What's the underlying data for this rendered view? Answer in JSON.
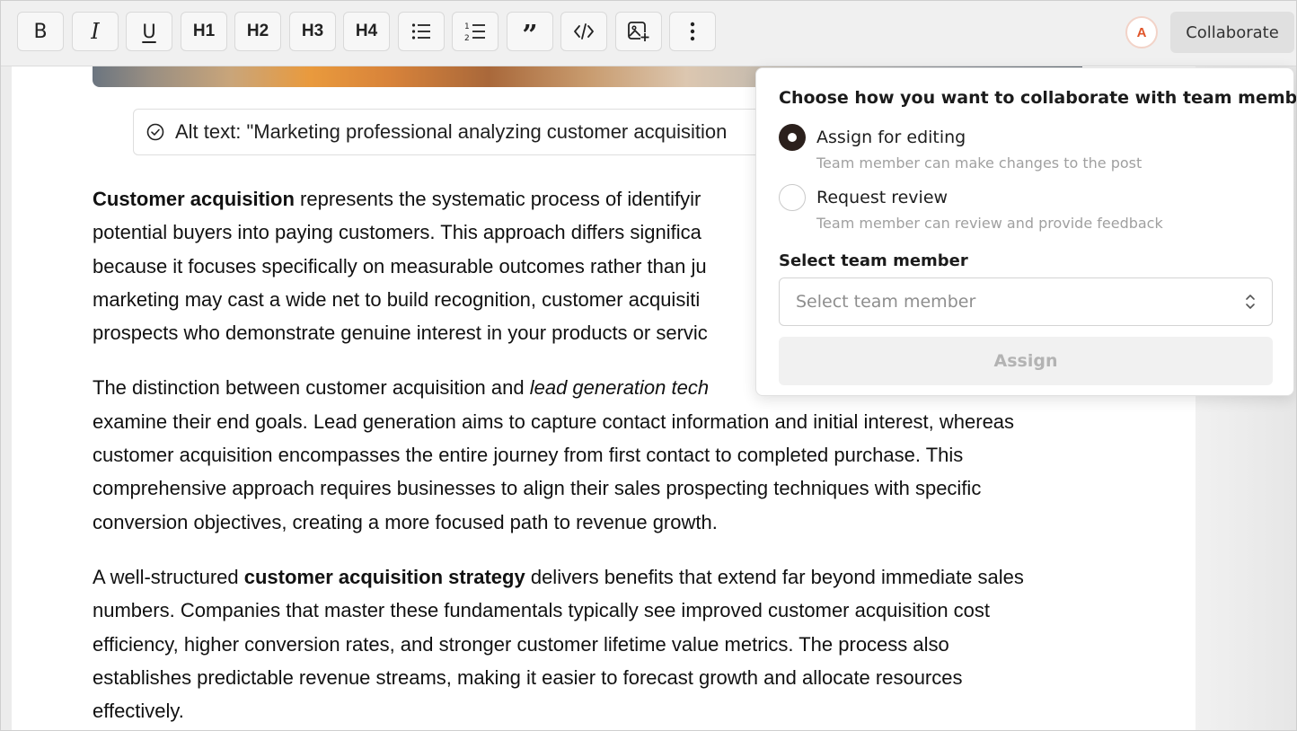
{
  "toolbar": {
    "buttons": [
      {
        "label": "B",
        "icon": "bold-icon"
      },
      {
        "label": "I",
        "icon": "italic-icon"
      },
      {
        "label": "U",
        "icon": "underline-icon"
      },
      {
        "label": "H1",
        "icon": "heading-1-icon"
      },
      {
        "label": "H2",
        "icon": "heading-2-icon"
      },
      {
        "label": "H3",
        "icon": "heading-3-icon"
      },
      {
        "label": "H4",
        "icon": "heading-4-icon"
      },
      {
        "icon": "bullet-list-icon"
      },
      {
        "icon": "numbered-list-icon"
      },
      {
        "icon": "quote-icon"
      },
      {
        "icon": "code-icon"
      },
      {
        "icon": "add-image-icon"
      },
      {
        "icon": "more-vertical-icon"
      }
    ],
    "avatar_initial": "A",
    "collaborate_label": "Collaborate"
  },
  "editor": {
    "alt_text": "Alt text: \"Marketing professional analyzing customer acquisition",
    "p1": {
      "bold": "Customer acquisition",
      "l1": " represents the systematic process of identifyir",
      "l2": "potential buyers into paying customers. This approach differs significa",
      "l3": "because it focuses specifically on measurable outcomes rather than ju",
      "l4": "marketing may cast a wide net to build recognition, customer acquisiti",
      "l5": "prospects who demonstrate genuine interest in your products or servic"
    },
    "p2": {
      "l1a": "The distinction between customer acquisition and ",
      "l1b": "lead generation tech",
      "l2": "examine their end goals. Lead generation aims to capture contact information and initial interest, whereas",
      "l3": "customer acquisition encompasses the entire journey from first contact to completed purchase. This",
      "l4": "comprehensive approach requires businesses to align their sales prospecting techniques with specific",
      "l5": "conversion objectives, creating a more focused path to revenue growth."
    },
    "p3": {
      "l1a": "A well-structured ",
      "l1b": "customer acquisition strategy",
      "l1c": " delivers benefits that extend far beyond immediate sales",
      "l2": "numbers. Companies that master these fundamentals typically see improved customer acquisition cost",
      "l3": "efficiency, higher conversion rates, and stronger customer lifetime value metrics. The process also",
      "l4": "establishes predictable revenue streams, making it easier to forecast growth and allocate resources",
      "l5": "effectively."
    }
  },
  "popover": {
    "title": "Choose how you want to collaborate with team members",
    "options": [
      {
        "label": "Assign for editing",
        "desc": "Team member can make changes to the post",
        "selected": true
      },
      {
        "label": "Request review",
        "desc": "Team member can review and provide feedback",
        "selected": false
      }
    ],
    "field_label": "Select team member",
    "select_placeholder": "Select team member",
    "assign_label": "Assign"
  },
  "colors": {
    "avatar_accent": "#e0552a",
    "radio_selected": "#2b201c"
  }
}
